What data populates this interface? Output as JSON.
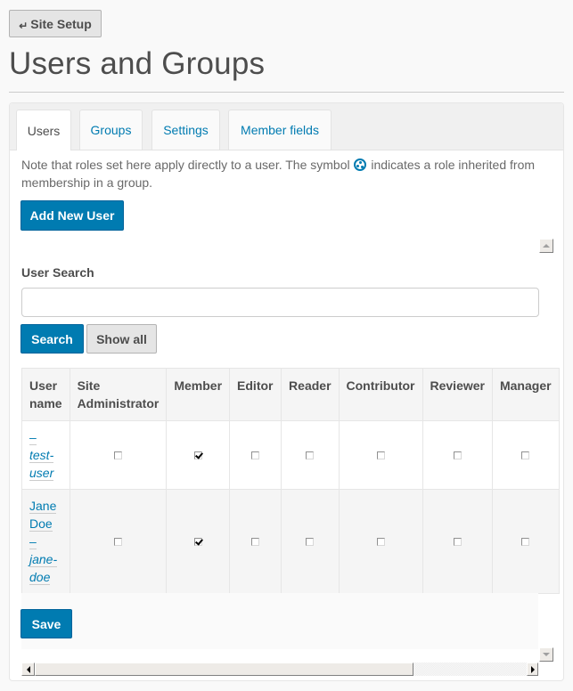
{
  "header": {
    "back_button_label": "Site Setup",
    "back_icon": "return-arrow-icon",
    "page_title": "Users and Groups"
  },
  "tabs": [
    {
      "label": "Users",
      "active": true
    },
    {
      "label": "Groups",
      "active": false
    },
    {
      "label": "Settings",
      "active": false
    },
    {
      "label": "Member fields",
      "active": false
    }
  ],
  "note": {
    "before_icon": "Note that roles set here apply directly to a user. The symbol ",
    "icon": "inherited-role-icon",
    "after_icon": " indicates a role inherited from membership in a group."
  },
  "add_user_label": "Add New User",
  "search": {
    "label": "User Search",
    "value": "",
    "placeholder": "",
    "search_label": "Search",
    "show_all_label": "Show all"
  },
  "table": {
    "columns": [
      "User name",
      "Site Administrator",
      "Member",
      "Editor",
      "Reader",
      "Contributor",
      "Reviewer",
      "Manager"
    ],
    "rows": [
      {
        "fullname": "",
        "separator": "–",
        "userid": "test-user",
        "roles": {
          "Site Administrator": false,
          "Member": true,
          "Editor": false,
          "Reader": false,
          "Contributor": false,
          "Reviewer": false,
          "Manager": false
        }
      },
      {
        "fullname": "Jane Doe",
        "separator": "–",
        "userid": "jane-doe",
        "roles": {
          "Site Administrator": false,
          "Member": true,
          "Editor": false,
          "Reader": false,
          "Contributor": false,
          "Reviewer": false,
          "Manager": false
        }
      }
    ]
  },
  "save_label": "Save",
  "colors": {
    "primary": "#007bb1",
    "link": "#007bb1",
    "text": "#4d4d4d"
  }
}
